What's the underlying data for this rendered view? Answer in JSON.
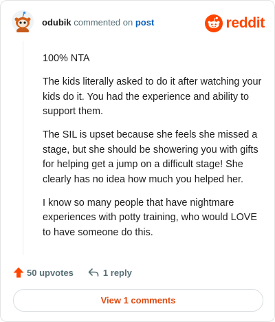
{
  "header": {
    "author": "odubik",
    "action": "commented on",
    "post_link": "post",
    "brand_name": "reddit"
  },
  "comment": {
    "paragraphs": [
      "100% NTA",
      "The kids literally asked to do it after watching your kids do it. You had the experience and ability to support them.",
      "The SIL is upset because she feels she missed a stage, but she should be showering you with gifts for helping get a jump on a difficult stage! She clearly has no idea how much you helped her.",
      "I know so many people that have nightmare experiences with potty training, who would LOVE to have someone do this."
    ]
  },
  "actions": {
    "upvotes_label": "50 upvotes",
    "reply_label": "1 reply"
  },
  "footer": {
    "view_comments_label": "View 1 comments"
  },
  "colors": {
    "brand": "#ff4500",
    "link": "#0a5fb8",
    "muted": "#576f76",
    "button_text": "#dd4a11"
  },
  "icons": [
    "snoo-avatar-icon",
    "reddit-logo-icon",
    "upvote-arrow-icon",
    "reply-arrow-icon"
  ]
}
